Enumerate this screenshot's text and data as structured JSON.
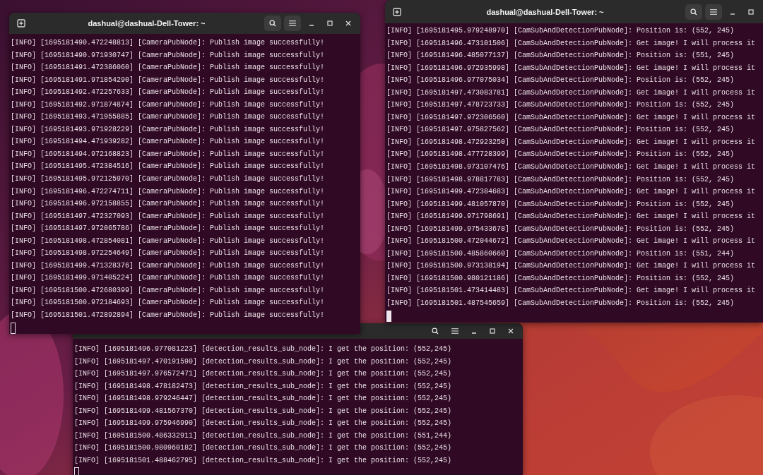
{
  "windows": [
    {
      "title": "dashual@dashual-Dell-Tower: ~",
      "focused": false,
      "title_buttons": [
        {
          "kind": "new_tab"
        },
        {
          "kind": "search"
        },
        {
          "kind": "menu"
        },
        {
          "kind": "minimize"
        },
        {
          "kind": "maximize"
        },
        {
          "kind": "close"
        }
      ],
      "lines": [
        "[INFO] [1695181490.472248813] [CameraPubNode]: Publish image successfully!",
        "[INFO] [1695181490.971930747] [CameraPubNode]: Publish image successfully!",
        "[INFO] [1695181491.472386060] [CameraPubNode]: Publish image successfully!",
        "[INFO] [1695181491.971854290] [CameraPubNode]: Publish image successfully!",
        "[INFO] [1695181492.472257633] [CameraPubNode]: Publish image successfully!",
        "[INFO] [1695181492.971874874] [CameraPubNode]: Publish image successfully!",
        "[INFO] [1695181493.471955885] [CameraPubNode]: Publish image successfully!",
        "[INFO] [1695181493.971928229] [CameraPubNode]: Publish image successfully!",
        "[INFO] [1695181494.471939282] [CameraPubNode]: Publish image successfully!",
        "[INFO] [1695181494.972168823] [CameraPubNode]: Publish image successfully!",
        "[INFO] [1695181495.472384516] [CameraPubNode]: Publish image successfully!",
        "[INFO] [1695181495.972125970] [CameraPubNode]: Publish image successfully!",
        "[INFO] [1695181496.472274711] [CameraPubNode]: Publish image successfully!",
        "[INFO] [1695181496.972158855] [CameraPubNode]: Publish image successfully!",
        "[INFO] [1695181497.472327093] [CameraPubNode]: Publish image successfully!",
        "[INFO] [1695181497.972065786] [CameraPubNode]: Publish image successfully!",
        "[INFO] [1695181498.472854081] [CameraPubNode]: Publish image successfully!",
        "[INFO] [1695181498.972254649] [CameraPubNode]: Publish image successfully!",
        "[INFO] [1695181499.471328376] [CameraPubNode]: Publish image successfully!",
        "[INFO] [1695181499.971405224] [CameraPubNode]: Publish image successfully!",
        "[INFO] [1695181500.472680399] [CameraPubNode]: Publish image successfully!",
        "[INFO] [1695181500.972184693] [CameraPubNode]: Publish image successfully!",
        "[INFO] [1695181501.472892894] [CameraPubNode]: Publish image successfully!"
      ]
    },
    {
      "title": "dashual@dashual-Dell-Tower: ~",
      "focused": true,
      "title_buttons": [
        {
          "kind": "new_tab"
        },
        {
          "kind": "search"
        },
        {
          "kind": "menu"
        },
        {
          "kind": "minimize"
        },
        {
          "kind": "maximize"
        }
      ],
      "lines": [
        "[INFO] [1695181495.979248970] [CamSubAndDetectionPubNode]: Position is: (552, 245)",
        "[INFO] [1695181496.473101506] [CamSubAndDetectionPubNode]: Get image! I will process it",
        "[INFO] [1695181496.485077137] [CamSubAndDetectionPubNode]: Position is: (551, 245)",
        "[INFO] [1695181496.972935998] [CamSubAndDetectionPubNode]: Get image! I will process it",
        "[INFO] [1695181496.977075034] [CamSubAndDetectionPubNode]: Position is: (552, 245)",
        "[INFO] [1695181497.473083781] [CamSubAndDetectionPubNode]: Get image! I will process it",
        "[INFO] [1695181497.478723733] [CamSubAndDetectionPubNode]: Position is: (552, 245)",
        "[INFO] [1695181497.972306560] [CamSubAndDetectionPubNode]: Get image! I will process it",
        "[INFO] [1695181497.975827562] [CamSubAndDetectionPubNode]: Position is: (552, 245)",
        "[INFO] [1695181498.472923250] [CamSubAndDetectionPubNode]: Get image! I will process it",
        "[INFO] [1695181498.477728399] [CamSubAndDetectionPubNode]: Position is: (552, 245)",
        "[INFO] [1695181498.973107476] [CamSubAndDetectionPubNode]: Get image! I will process it",
        "[INFO] [1695181498.978817783] [CamSubAndDetectionPubNode]: Position is: (552, 245)",
        "[INFO] [1695181499.472384683] [CamSubAndDetectionPubNode]: Get image! I will process it",
        "[INFO] [1695181499.481057870] [CamSubAndDetectionPubNode]: Position is: (552, 245)",
        "[INFO] [1695181499.971798691] [CamSubAndDetectionPubNode]: Get image! I will process it",
        "[INFO] [1695181499.975433678] [CamSubAndDetectionPubNode]: Position is: (552, 245)",
        "[INFO] [1695181500.472044672] [CamSubAndDetectionPubNode]: Get image! I will process it",
        "[INFO] [1695181500.485860660] [CamSubAndDetectionPubNode]: Position is: (551, 244)",
        "[INFO] [1695181500.973138194] [CamSubAndDetectionPubNode]: Get image! I will process it",
        "[INFO] [1695181500.980121186] [CamSubAndDetectionPubNode]: Position is: (552, 245)",
        "[INFO] [1695181501.473414483] [CamSubAndDetectionPubNode]: Get image! I will process it",
        "[INFO] [1695181501.487545659] [CamSubAndDetectionPubNode]: Position is: (552, 245)"
      ]
    },
    {
      "focused": false,
      "title_buttons": [
        {
          "kind": "search"
        },
        {
          "kind": "menu"
        },
        {
          "kind": "minimize"
        },
        {
          "kind": "maximize"
        },
        {
          "kind": "close"
        }
      ],
      "lines": [
        "[INFO] [1695181496.977081223] [detection_results_sub_node]: I get the position: (552,245)",
        "[INFO] [1695181497.470191590] [detection_results_sub_node]: I get the position: (552,245)",
        "[INFO] [1695181497.976572471] [detection_results_sub_node]: I get the position: (552,245)",
        "[INFO] [1695181498.478182473] [detection_results_sub_node]: I get the position: (552,245)",
        "[INFO] [1695181498.979246447] [detection_results_sub_node]: I get the position: (552,245)",
        "[INFO] [1695181499.481567370] [detection_results_sub_node]: I get the position: (552,245)",
        "[INFO] [1695181499.975946990] [detection_results_sub_node]: I get the position: (552,245)",
        "[INFO] [1695181500.486332911] [detection_results_sub_node]: I get the position: (551,244)",
        "[INFO] [1695181500.980960182] [detection_results_sub_node]: I get the position: (552,245)",
        "[INFO] [1695181501.488462795] [detection_results_sub_node]: I get the position: (552,245)"
      ]
    }
  ]
}
